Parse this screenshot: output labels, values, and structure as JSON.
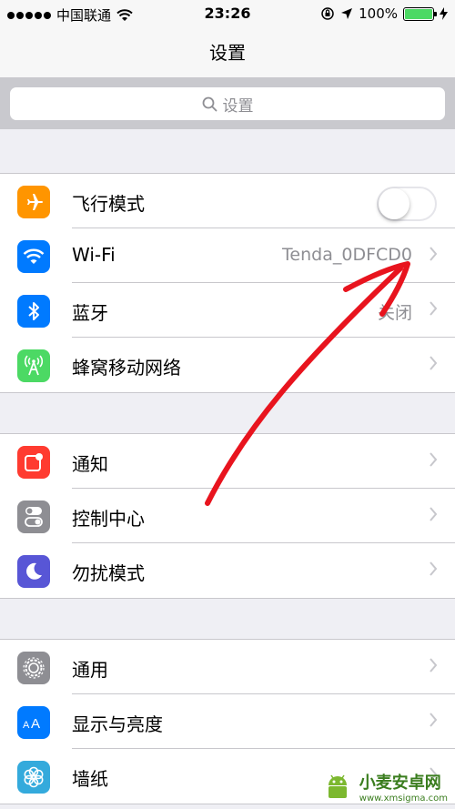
{
  "statusbar": {
    "carrier": "中国联通",
    "time": "23:26",
    "battery_percent": "100%",
    "battery_level": 1.0
  },
  "nav": {
    "title": "设置"
  },
  "search": {
    "placeholder": "设置"
  },
  "group1": [
    {
      "label": "飞行模式",
      "icon": "airplane-icon",
      "color": "#ff9500",
      "toggle_on": false
    },
    {
      "label": "Wi-Fi",
      "icon": "wifi-icon",
      "color": "#007aff",
      "value": "Tenda_0DFCD0"
    },
    {
      "label": "蓝牙",
      "icon": "bluetooth-icon",
      "color": "#007aff",
      "value": "关闭"
    },
    {
      "label": "蜂窝移动网络",
      "icon": "cellular-icon",
      "color": "#4cd964"
    }
  ],
  "group2": [
    {
      "label": "通知",
      "icon": "notifications-icon",
      "color": "#ff3b30"
    },
    {
      "label": "控制中心",
      "icon": "control-center-icon",
      "color": "#8e8e93"
    },
    {
      "label": "勿扰模式",
      "icon": "moon-icon",
      "color": "#5856d6"
    }
  ],
  "group3": [
    {
      "label": "通用",
      "icon": "gear-icon",
      "color": "#8e8e93"
    },
    {
      "label": "显示与亮度",
      "icon": "display-icon",
      "color": "#007aff"
    },
    {
      "label": "墙纸",
      "icon": "wallpaper-icon",
      "color": "#34aadc"
    }
  ],
  "watermark": {
    "title": "小麦安卓网",
    "url": "www.xmsigma.com"
  },
  "colors": {
    "annotation_arrow": "#e8141e"
  }
}
